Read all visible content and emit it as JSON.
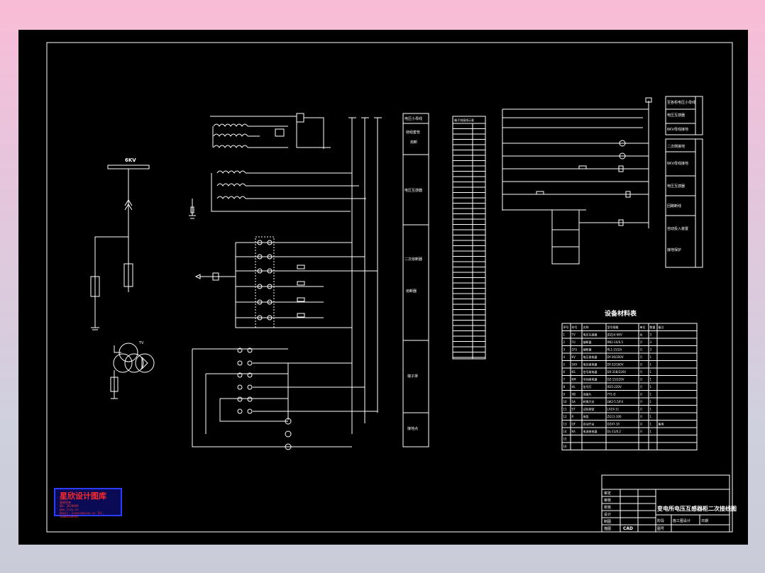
{
  "drawing": {
    "title": "变电所电压互感器柜二次接线图",
    "busbar_label": "6KV",
    "materials_title": "设备材料表",
    "function_column": [
      "电压小母线",
      "绕组套管",
      "熔断",
      "电压互感器",
      "二次熔断器",
      "熔断器",
      "端子排",
      "接地点"
    ],
    "terminal_title": "端子排接线示意",
    "right_labels": [
      "至各柜电压小母线",
      "电压互感器",
      "6KV母线接地",
      "二次侧接地",
      "6KV母线接地",
      "电压互感器",
      "回路断线",
      "自动投入装置",
      "接地保护"
    ],
    "materials_headers": [
      "序号",
      "符号",
      "名称",
      "型号规格",
      "单位",
      "数量",
      "备注"
    ],
    "materials_rows": [
      [
        "1",
        "TV",
        "电压互感器",
        "JDZJ-6 6KV",
        "台",
        "3",
        ""
      ],
      [
        "2",
        "FU",
        "熔断器",
        "RN2-10/0.5",
        "只",
        "3",
        ""
      ],
      [
        "3",
        "1FU",
        "熔断器",
        "RL1-15/2A",
        "只",
        "3",
        ""
      ],
      [
        "4",
        "KV",
        "电压继电器",
        "DY-36/200V",
        "只",
        "1",
        ""
      ],
      [
        "5",
        "1KV",
        "电压继电器",
        "DY-32/160V",
        "只",
        "1",
        ""
      ],
      [
        "6",
        "KS",
        "信号继电器",
        "DX-31B/220V",
        "只",
        "1",
        ""
      ],
      [
        "7",
        "KM",
        "中间继电器",
        "DZ-15/220V",
        "只",
        "1",
        ""
      ],
      [
        "8",
        "HL",
        "信号灯",
        "XD5-220V",
        "只",
        "1",
        ""
      ],
      [
        "9",
        "XB",
        "连接片",
        "YY1-D",
        "只",
        "1",
        ""
      ],
      [
        "10",
        "SA",
        "转换开关",
        "LW2-5.5/F4",
        "只",
        "1",
        ""
      ],
      [
        "11",
        "ST",
        "试验按钮",
        "LA19-11",
        "只",
        "1",
        ""
      ],
      [
        "12",
        "R",
        "电阻",
        "ZG11-100",
        "只",
        "1",
        ""
      ],
      [
        "13",
        "QF",
        "自动开关",
        "DZ47-10",
        "只",
        "1",
        "备用"
      ],
      [
        "14",
        "KA",
        "电流继电器",
        "DL-11/0.2",
        "只",
        "1",
        ""
      ],
      [
        "15",
        "",
        "",
        "",
        "",
        "",
        ""
      ],
      [
        "16",
        "",
        "",
        "",
        "",
        "",
        ""
      ]
    ],
    "title_block": {
      "rows": [
        "审定",
        "审核",
        "校核",
        "设计",
        "制图",
        "描图"
      ],
      "stage_label": "阶段",
      "stage_value": "施工图设计",
      "date_label": "日期",
      "number_label": "图号",
      "cad_label": "CAD"
    }
  },
  "logo": {
    "title": "星欣设计图库",
    "line1": "版权所有",
    "line2": "QQ: 2929899",
    "line3": "www.1ivy.cn",
    "line4": "Email: xinxin@sina.cn  Tel: 13901234567"
  }
}
